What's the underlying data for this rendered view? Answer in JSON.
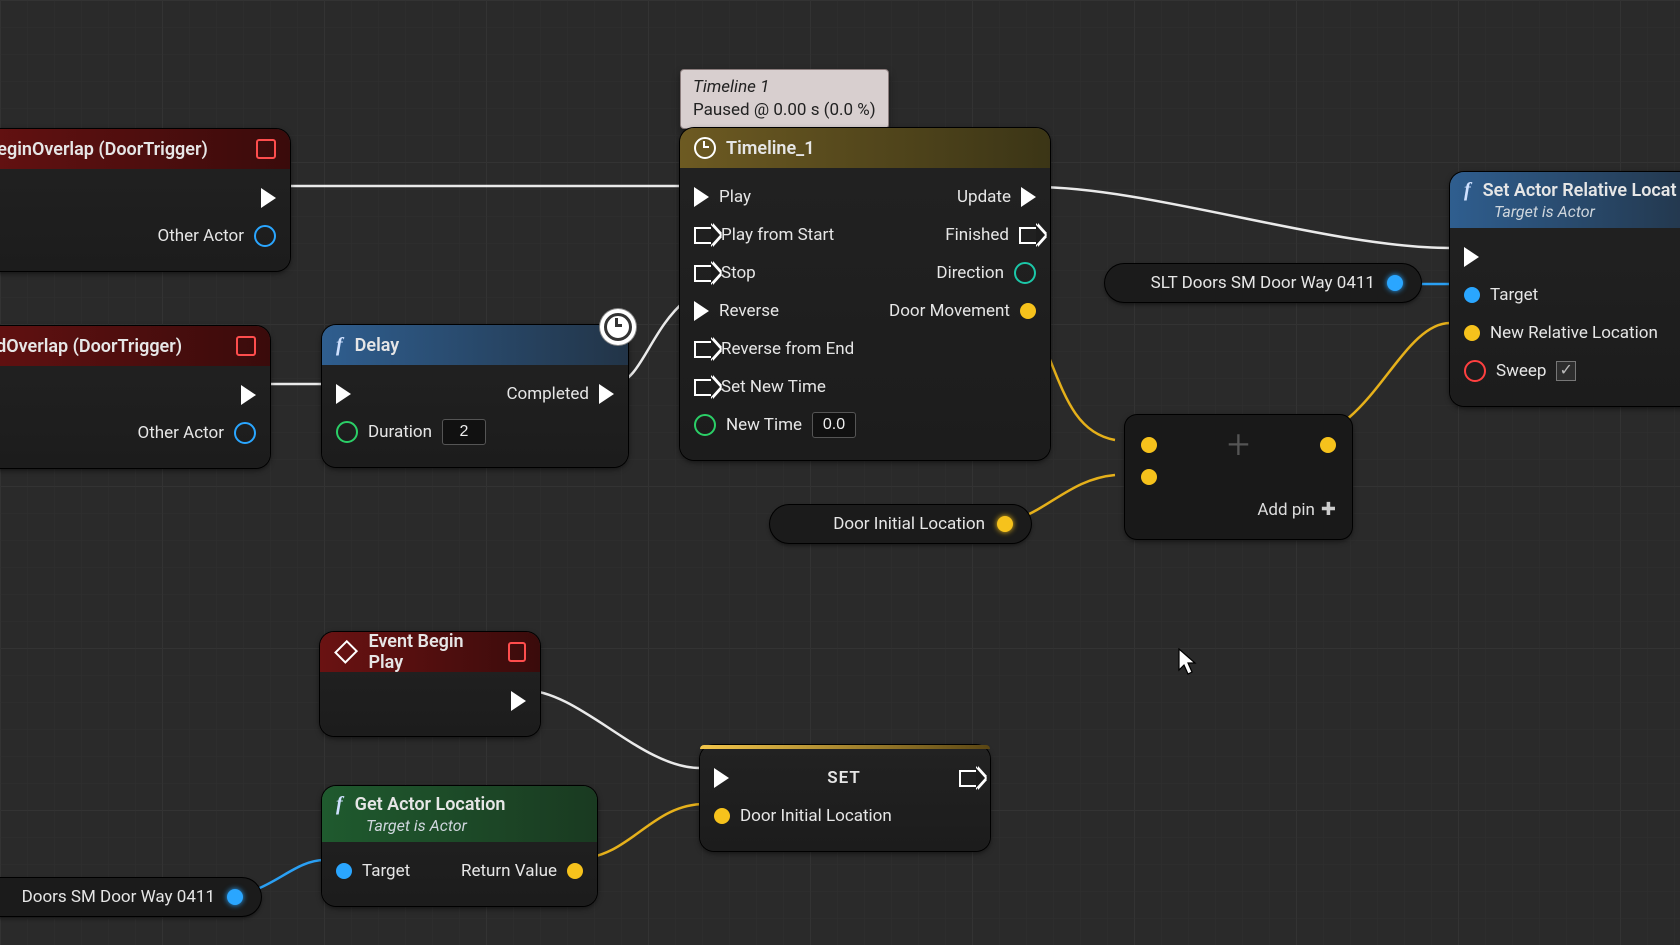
{
  "tooltip": {
    "line1": "Timeline 1",
    "line2": "Paused @ 0.00 s (0.0 %)"
  },
  "nodes": {
    "beginOverlap": {
      "title": "ctorBeginOverlap (DoorTrigger)",
      "otherActor": "Other Actor"
    },
    "endOverlap": {
      "title": "ctorEndOverlap (DoorTrigger)",
      "otherActor": "Other Actor"
    },
    "delay": {
      "title": "Delay",
      "completed": "Completed",
      "duration": "Duration",
      "durationVal": "2"
    },
    "timeline": {
      "title": "Timeline_1",
      "play": "Play",
      "playStart": "Play from Start",
      "stop": "Stop",
      "reverse": "Reverse",
      "revEnd": "Reverse from End",
      "setNew": "Set New Time",
      "newTime": "New Time",
      "newTimeVal": "0.0",
      "update": "Update",
      "finished": "Finished",
      "direction": "Direction",
      "doorMove": "Door Movement"
    },
    "varDoorInit": {
      "label": "Door Initial Location"
    },
    "varSltTop": {
      "label": "SLT Doors SM Door Way 0411"
    },
    "varSltBot": {
      "label": "Doors SM Door Way 0411"
    },
    "add": {
      "addPin": "Add pin"
    },
    "setRel": {
      "title": "Set Actor Relative Locat",
      "sub": "Target is Actor",
      "target": "Target",
      "newRel": "New Relative Location",
      "sweep": "Sweep"
    },
    "eventBegin": {
      "title": "Event Begin Play"
    },
    "getLoc": {
      "title": "Get Actor Location",
      "sub": "Target is Actor",
      "target": "Target",
      "retval": "Return Value"
    },
    "setNode": {
      "title": "SET",
      "doorInit": "Door Initial Location"
    }
  }
}
